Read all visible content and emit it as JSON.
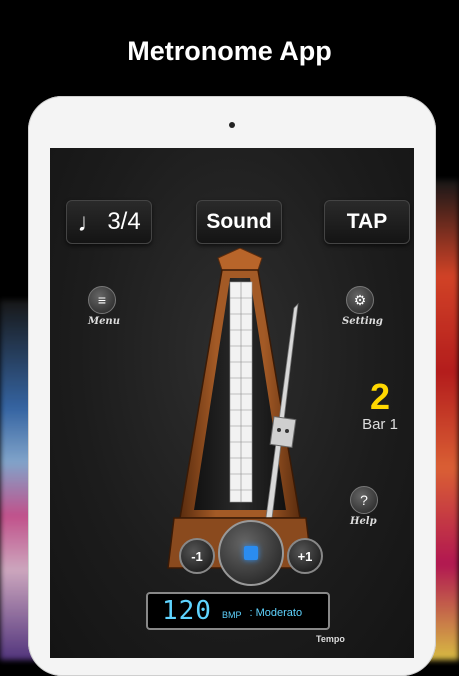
{
  "headline": "Metronome App",
  "toolbar": {
    "time_signature": "3/4",
    "sound_label": "Sound",
    "tap_label": "TAP"
  },
  "side": {
    "menu_label": "Menu",
    "setting_label": "Setting",
    "help_label": "Help",
    "help_symbol": "?"
  },
  "beat": {
    "current_beat": "2",
    "bar_label": "Bar 1"
  },
  "controls": {
    "minus_label": "-1",
    "plus_label": "+1"
  },
  "tempo": {
    "bpm": "120",
    "unit": "BMP",
    "marking": ": Moderato",
    "label": "Tempo"
  },
  "colors": {
    "accent_beat": "#ffd800",
    "display_text": "#5fd4ff",
    "stop_button": "#2a8cf0",
    "wood": "#8a4a1e"
  }
}
